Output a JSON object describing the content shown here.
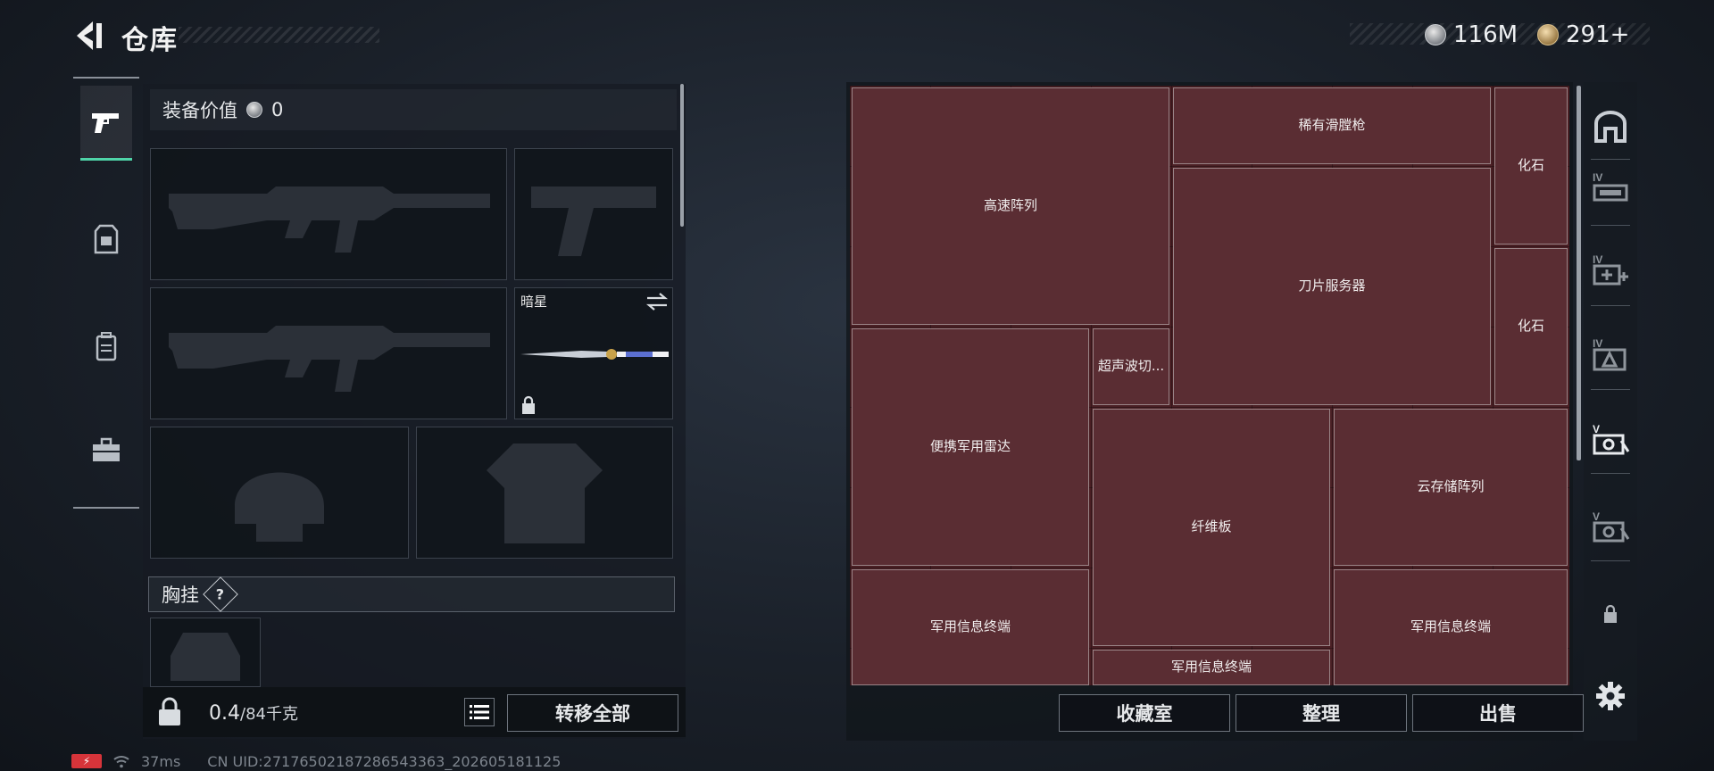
{
  "header": {
    "title": "仓库",
    "currency_silver": "116M",
    "currency_gold": "291+"
  },
  "equipment": {
    "value_label": "装备价值",
    "value": "0",
    "melee_label": "暗星",
    "chest_rig_label": "胸挂",
    "help_glyph": "?"
  },
  "weight": {
    "current": "0.4",
    "max": "/84千克"
  },
  "buttons": {
    "transfer_all": "转移全部",
    "collection_room": "收藏室",
    "organize": "整理",
    "sell": "出售"
  },
  "storage_items": [
    {
      "name": "高速阵列",
      "icon": "storage-server-icon"
    },
    {
      "name": "稀有滑膛枪",
      "icon": "musket-icon"
    },
    {
      "name": "化石",
      "icon": "claw-fossil-icon"
    },
    {
      "name": "刀片服务器",
      "icon": "blade-server-icon"
    },
    {
      "name": "化石",
      "icon": "claw-fossil-icon"
    },
    {
      "name": "便携军用雷达",
      "icon": "military-radar-icon"
    },
    {
      "name": "超声波切...",
      "icon": "ultrasonic-cutter-icon"
    },
    {
      "name": "纤维板",
      "icon": "fiber-board-icon"
    },
    {
      "name": "云存储阵列",
      "icon": "cloud-storage-icon"
    },
    {
      "name": "军用信息终端",
      "icon": "military-terminal-icon"
    },
    {
      "name": "军用信息终端",
      "icon": "military-terminal-icon"
    },
    {
      "name": "军用信息终端",
      "icon": "military-terminal-icon"
    }
  ],
  "sidebar_icons": [
    "container-icon",
    "tier-iv-device-icon",
    "tier-iv-medkit-icon",
    "tier-iv-armor-icon",
    "tier-v-device-icon",
    "tier-v-device-icon",
    "lock-icon"
  ],
  "status": {
    "ping": "37ms",
    "uid": "CN UID:27176502187286543363_202605181125"
  },
  "colors": {
    "grid_background": "#4a1f24",
    "active_tab_accent": "#4fd4a8",
    "battery": "#d6343a"
  }
}
